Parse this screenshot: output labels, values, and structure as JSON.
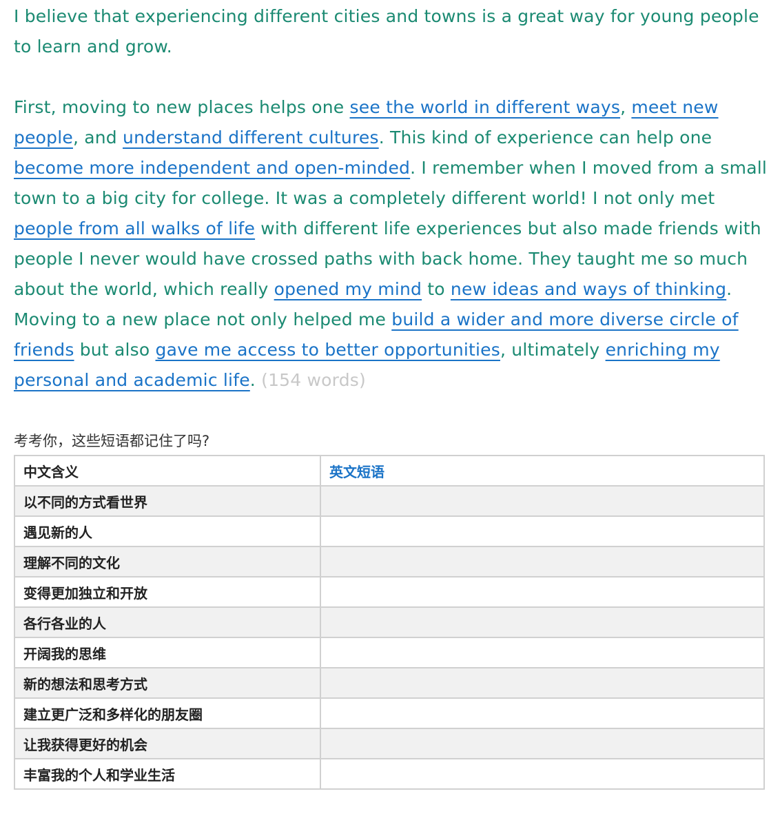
{
  "essay": {
    "p1": "I believe that experiencing different cities and towns is a great way for young people to learn and grow.",
    "p2": {
      "t1": "First, moving to new places helps one ",
      "ph1": "see the world in different ways",
      "t2": ", ",
      "ph2": "meet new people",
      "t3": ", and ",
      "ph3": "understand different cultures",
      "t4": ". This kind of experience can help one ",
      "ph4": "become more independent and open-minded",
      "t5": ". I remember when I moved from a small town to a big city for college. It was a completely different world! I not only met ",
      "ph5": "people from all walks of life",
      "t6": " with different life experiences but also made friends with people I never would have crossed paths with back home. They taught me so much about the world, which really ",
      "ph6": "opened my mind",
      "t7": " to ",
      "ph7": "new ideas and ways of thinking",
      "t8": ". Moving to a new place not only helped me ",
      "ph8": "build a wider and more diverse circle of friends",
      "t9": " but also ",
      "ph9": "gave me access to better opportunities",
      "t10": ", ultimately ",
      "ph10": "enriching my personal and academic life",
      "t11": ".",
      "word_count": "(154 words)"
    }
  },
  "quiz": {
    "title": "考考你，这些短语都记住了吗?",
    "headers": {
      "zh": "中文含义",
      "en": "英文短语"
    },
    "rows": [
      {
        "zh": "以不同的方式看世界",
        "en": ""
      },
      {
        "zh": "遇见新的人",
        "en": ""
      },
      {
        "zh": "理解不同的文化",
        "en": ""
      },
      {
        "zh": "变得更加独立和开放",
        "en": ""
      },
      {
        "zh": "各行各业的人",
        "en": ""
      },
      {
        "zh": "开阔我的思维",
        "en": ""
      },
      {
        "zh": "新的想法和思考方式",
        "en": ""
      },
      {
        "zh": "建立更广泛和多样化的朋友圈",
        "en": ""
      },
      {
        "zh": "让我获得更好的机会",
        "en": ""
      },
      {
        "zh": "丰富我的个人和学业生活",
        "en": ""
      }
    ]
  },
  "colors": {
    "text": "#1b8a72",
    "phrase": "#1a73c7",
    "count": "#c8c8c8",
    "row_alt": "#f1f1f1",
    "border": "#d0d0d0"
  }
}
